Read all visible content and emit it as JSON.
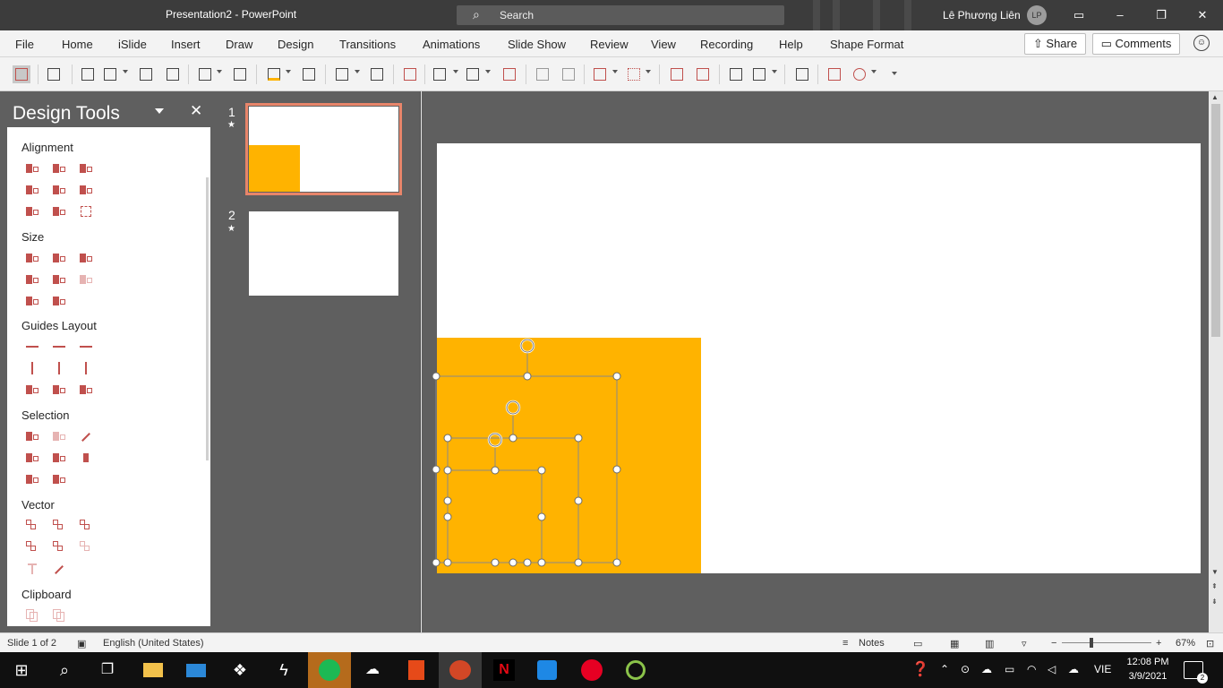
{
  "window": {
    "title": "Presentation2  -  PowerPoint",
    "search_placeholder": "Search",
    "user_name": "Lê Phương Liên",
    "user_initials": "LP"
  },
  "menu": {
    "tabs": [
      "File",
      "Home",
      "iSlide",
      "Insert",
      "Draw",
      "Design",
      "Transitions",
      "Animations",
      "Slide Show",
      "Review",
      "View",
      "Recording",
      "Help",
      "Shape Format"
    ],
    "share": "Share",
    "comments": "Comments"
  },
  "design_tools": {
    "title": "Design Tools",
    "groups": [
      {
        "name": "Alignment"
      },
      {
        "name": "Size"
      },
      {
        "name": "Guides Layout"
      },
      {
        "name": "Selection"
      },
      {
        "name": "Vector"
      },
      {
        "name": "Clipboard"
      }
    ]
  },
  "slides": [
    {
      "number": "1",
      "star": "★"
    },
    {
      "number": "2",
      "star": "★"
    }
  ],
  "colors": {
    "shape_fill": "#FFB300",
    "accent": "#c0504d",
    "thumb_selected": "#e8856a"
  },
  "status": {
    "slide": "Slide 1 of 2",
    "language": "English (United States)",
    "notes": "Notes",
    "zoom": "67%",
    "zoom_minus": "−",
    "zoom_plus": "+"
  },
  "taskbar": {
    "lang": "VIE",
    "time": "12:08 PM",
    "date": "3/9/2021",
    "notifications": "2"
  }
}
